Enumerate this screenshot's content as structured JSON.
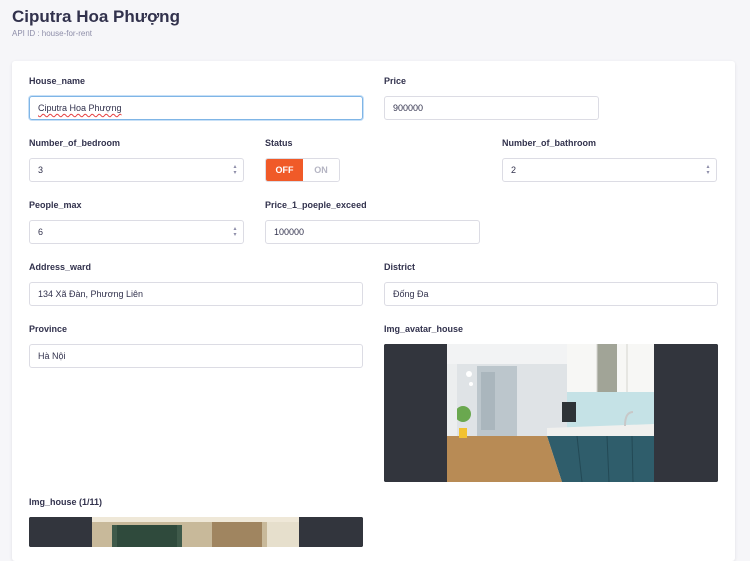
{
  "header": {
    "title": "Ciputra Hoa Phượng",
    "subtitle": "API ID : house-for-rent"
  },
  "form": {
    "house_name": {
      "label": "House_name",
      "value": "Ciputra Hoa Phượng"
    },
    "price": {
      "label": "Price",
      "value": "900000"
    },
    "number_of_bedroom": {
      "label": "Number_of_bedroom",
      "value": "3"
    },
    "status": {
      "label": "Status",
      "off_label": "OFF",
      "on_label": "ON",
      "selected": "OFF"
    },
    "number_of_bathroom": {
      "label": "Number_of_bathroom",
      "value": "2"
    },
    "people_max": {
      "label": "People_max",
      "value": "6"
    },
    "price_1_people_exceed": {
      "label": "Price_1_poeple_exceed",
      "value": "100000"
    },
    "address_ward": {
      "label": "Address_ward",
      "value": "134 Xã Đàn, Phương Liên"
    },
    "district": {
      "label": "District",
      "value": "Đống Đa"
    },
    "province": {
      "label": "Province",
      "value": "Hà Nội"
    },
    "img_avatar_house": {
      "label": "Img_avatar_house"
    },
    "img_house": {
      "label": "Img_house (1/11)"
    }
  },
  "colors": {
    "toggle_off": "#f05a28",
    "image_backdrop": "#32353d",
    "focus_border": "#7fb5e6"
  }
}
